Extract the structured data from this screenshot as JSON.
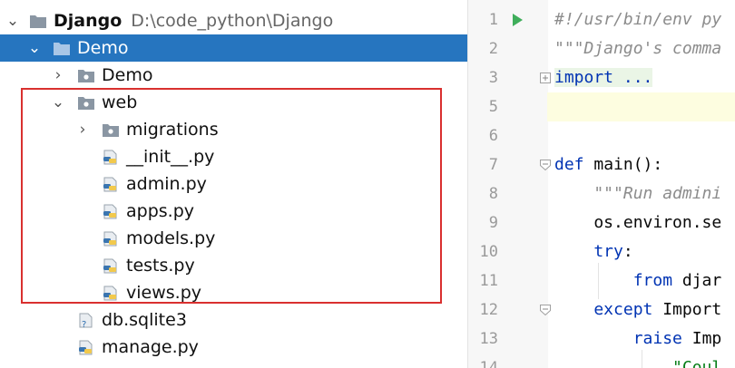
{
  "tree": {
    "root": {
      "name": "Django",
      "path": "D:\\code_python\\Django"
    },
    "items": [
      {
        "label": "Demo",
        "icon": "folder-icon"
      },
      {
        "label": "Demo",
        "icon": "package-folder-icon"
      },
      {
        "label": "web",
        "icon": "package-folder-icon"
      },
      {
        "label": "migrations",
        "icon": "package-folder-icon"
      },
      {
        "label": "__init__.py",
        "icon": "python-file-icon"
      },
      {
        "label": "admin.py",
        "icon": "python-file-icon"
      },
      {
        "label": "apps.py",
        "icon": "python-file-icon"
      },
      {
        "label": "models.py",
        "icon": "python-file-icon"
      },
      {
        "label": "tests.py",
        "icon": "python-file-icon"
      },
      {
        "label": "views.py",
        "icon": "python-file-icon"
      },
      {
        "label": "db.sqlite3",
        "icon": "unknown-file-icon"
      },
      {
        "label": "manage.py",
        "icon": "python-file-icon"
      }
    ],
    "highlight_color": "#d9302f",
    "selection_color": "#2675bf"
  },
  "editor": {
    "line_numbers": [
      "1",
      "2",
      "3",
      "5",
      "6",
      "7",
      "8",
      "9",
      "10",
      "11",
      "12",
      "13",
      "14"
    ],
    "lines": [
      {
        "t1": "#!/usr/bin/env py"
      },
      {
        "t1": "\"\"\"Django's comma"
      },
      {
        "t1": "import ..."
      },
      {
        "t1": ""
      },
      {
        "t1": ""
      },
      {
        "t1": "def",
        "t2": " main():"
      },
      {
        "t1": "    \"\"\"Run admini"
      },
      {
        "t1": "    os.environ.se"
      },
      {
        "t1": "    try",
        "t2": ":"
      },
      {
        "t1": "        from",
        "t2": " djar"
      },
      {
        "t1": "    except",
        "t2": " Import"
      },
      {
        "t1": "        raise",
        "t2": " Imp"
      },
      {
        "t1": "            \"Coul"
      }
    ]
  }
}
